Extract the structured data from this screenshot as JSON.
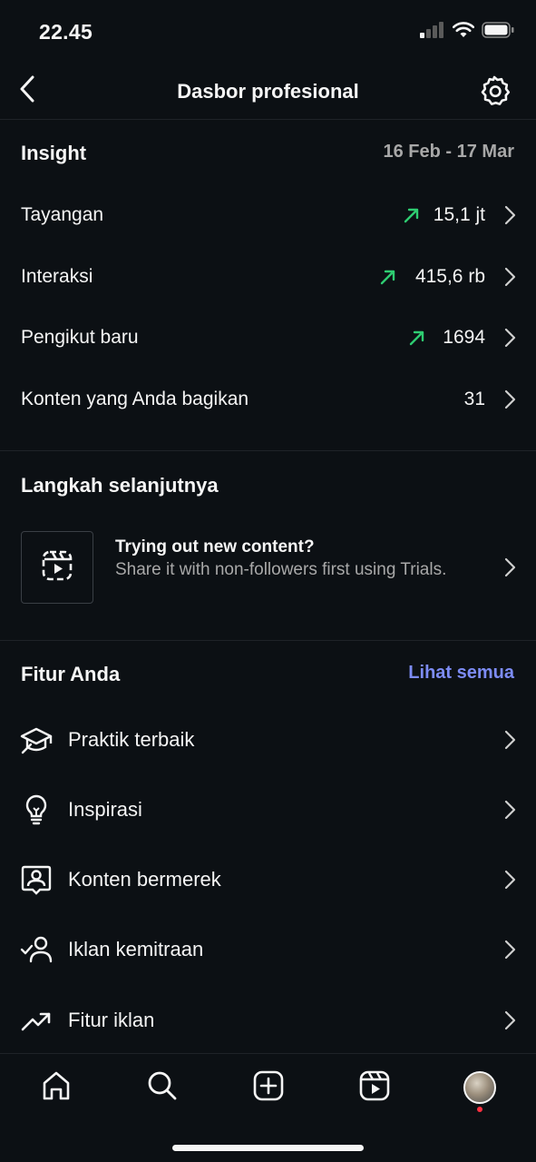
{
  "status_bar": {
    "time": "22.45",
    "signal_icon": "signal-icon",
    "wifi_icon": "wifi-icon",
    "battery_icon": "battery-icon"
  },
  "header": {
    "title": "Dasbor profesional",
    "back_icon": "chevron-left-icon",
    "settings_icon": "gear-icon"
  },
  "insight": {
    "title": "Insight",
    "date_range": "16 Feb - 17 Mar",
    "metrics": [
      {
        "label": "Tayangan",
        "value": "15,1 jt",
        "trend": "up"
      },
      {
        "label": "Interaksi",
        "value": "415,6 rb",
        "trend": "up"
      },
      {
        "label": "Pengikut baru",
        "value": "1694",
        "trend": "up"
      },
      {
        "label": "Konten yang Anda bagikan",
        "value": "31",
        "trend": "none"
      }
    ]
  },
  "next_steps": {
    "title": "Langkah selanjutnya",
    "card": {
      "title": "Trying out new content?",
      "description": "Share it with non-followers first using Trials.",
      "icon": "reels-trial-icon"
    }
  },
  "features": {
    "title": "Fitur Anda",
    "see_all": "Lihat semua",
    "items": [
      {
        "label": "Praktik terbaik",
        "icon": "graduation-cap-icon"
      },
      {
        "label": "Inspirasi",
        "icon": "lightbulb-icon"
      },
      {
        "label": "Konten bermerek",
        "icon": "branded-content-icon"
      },
      {
        "label": "Iklan kemitraan",
        "icon": "partner-ads-icon"
      },
      {
        "label": "Fitur iklan",
        "icon": "trending-up-icon"
      }
    ]
  },
  "tab_bar": {
    "tabs": [
      "home-icon",
      "search-icon",
      "create-icon",
      "reels-icon",
      "profile-avatar"
    ]
  },
  "colors": {
    "background": "#0c1014",
    "accent_link": "#7d8cf5",
    "trend_up": "#2ecc71",
    "notification": "#ff3040"
  }
}
